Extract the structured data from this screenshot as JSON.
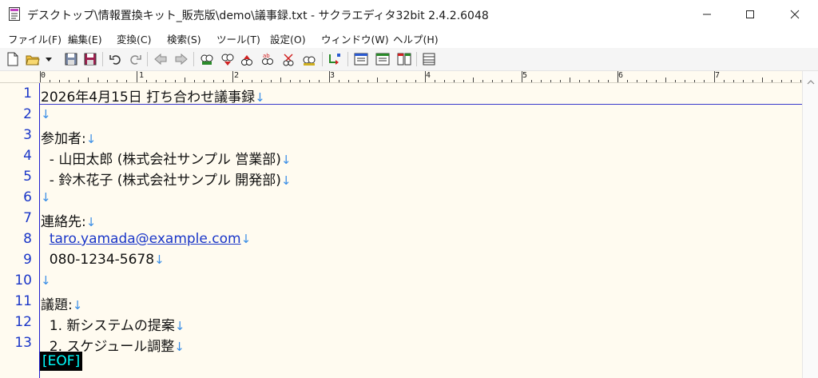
{
  "window": {
    "title": "デスクトップ\\情報置換キット_販売版\\demo\\議事録.txt - サクラエディタ32bit 2.4.2.6048"
  },
  "menu": {
    "items": [
      "ファイル(F)",
      "編集(E)",
      "変換(C)",
      "検索(S)",
      "ツール(T)",
      "設定(O)",
      "ウィンドウ(W)",
      "ヘルプ(H)"
    ]
  },
  "toolbar": {
    "icons": [
      "new-file-icon",
      "open-folder-icon",
      "dropdown-icon",
      "save-icon",
      "save-all-icon",
      "undo-icon",
      "redo-icon",
      "jump-back-icon",
      "jump-forward-icon",
      "search-icon",
      "search-prev-icon",
      "search-next-icon",
      "mark-icon",
      "replace-icon",
      "grep-icon",
      "outline-icon",
      "tag-jump-icon",
      "window-list-icon",
      "compare-icon",
      "split-window-icon",
      "settings-icon"
    ]
  },
  "ruler": {
    "labels": [
      "0",
      "1",
      "2",
      "3",
      "4",
      "5",
      "6",
      "7"
    ]
  },
  "editor": {
    "lines": [
      {
        "num": "1",
        "text": "2026年4月15日 打ち合わせ議事録",
        "nl": "↓"
      },
      {
        "num": "2",
        "text": "",
        "nl": "↓"
      },
      {
        "num": "3",
        "text": "参加者:",
        "nl": "↓"
      },
      {
        "num": "4",
        "text": "  - 山田太郎 (株式会社サンプル 営業部)",
        "nl": "↓"
      },
      {
        "num": "5",
        "text": "  - 鈴木花子 (株式会社サンプル 開発部)",
        "nl": "↓"
      },
      {
        "num": "6",
        "text": "",
        "nl": "↓"
      },
      {
        "num": "7",
        "text": "連絡先:",
        "nl": "↓"
      },
      {
        "num": "8",
        "text": "taro.yamada@example.com",
        "nl": "↓",
        "link": true
      },
      {
        "num": "9",
        "text": "  080-1234-5678",
        "nl": "↓"
      },
      {
        "num": "10",
        "text": "",
        "nl": "↓"
      },
      {
        "num": "11",
        "text": "議題:",
        "nl": "↓"
      },
      {
        "num": "12",
        "text": "  1. 新システムの提案",
        "nl": "↓"
      },
      {
        "num": "13",
        "text": "  2. スケジュール調整",
        "nl": "↓"
      }
    ],
    "eof": "[EOF]"
  },
  "colors": {
    "background": "#fffbf0",
    "line_number": "#1a36c8",
    "newline_mark": "#3a8ee6",
    "eof_bg": "#000000",
    "eof_fg": "#00ffff"
  }
}
